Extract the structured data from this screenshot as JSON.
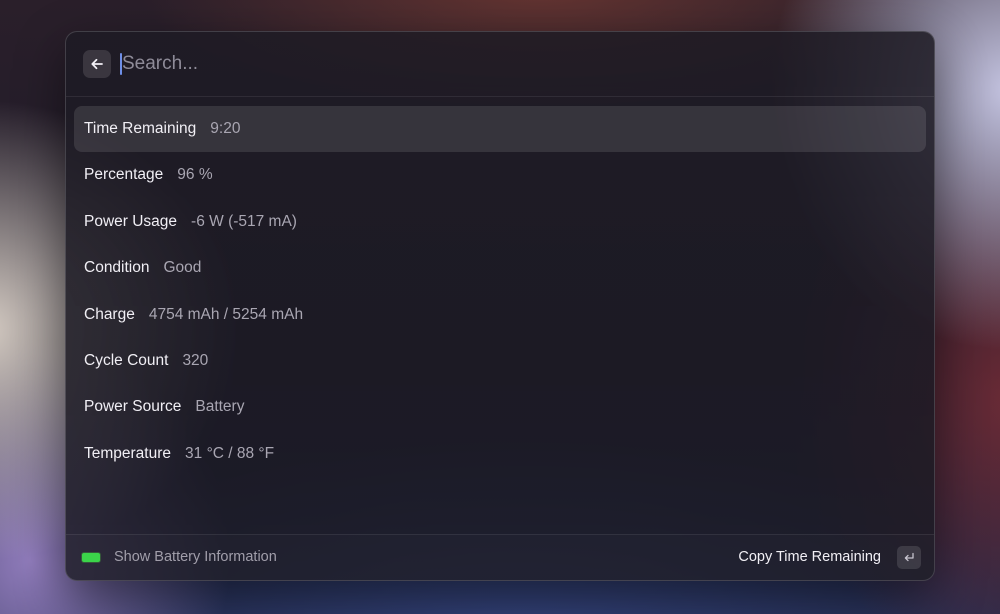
{
  "search": {
    "placeholder": "Search..."
  },
  "icons": {
    "back": "arrow-left-icon",
    "battery": "battery-icon",
    "enter": "return-key-icon"
  },
  "colors": {
    "battery_accent": "#3bd44a",
    "caret": "#6f8fe8"
  },
  "items": [
    {
      "title": "Time Remaining",
      "value": "9:20",
      "selected": true
    },
    {
      "title": "Percentage",
      "value": "96 %"
    },
    {
      "title": "Power Usage",
      "value": "-6 W (-517 mA)"
    },
    {
      "title": "Condition",
      "value": "Good"
    },
    {
      "title": "Charge",
      "value": "4754 mAh / 5254 mAh"
    },
    {
      "title": "Cycle Count",
      "value": "320"
    },
    {
      "title": "Power Source",
      "value": "Battery"
    },
    {
      "title": "Temperature",
      "value": "31 °C / 88 °F"
    }
  ],
  "footer": {
    "command_title": "Show Battery Information",
    "primary_action": "Copy Time Remaining"
  }
}
